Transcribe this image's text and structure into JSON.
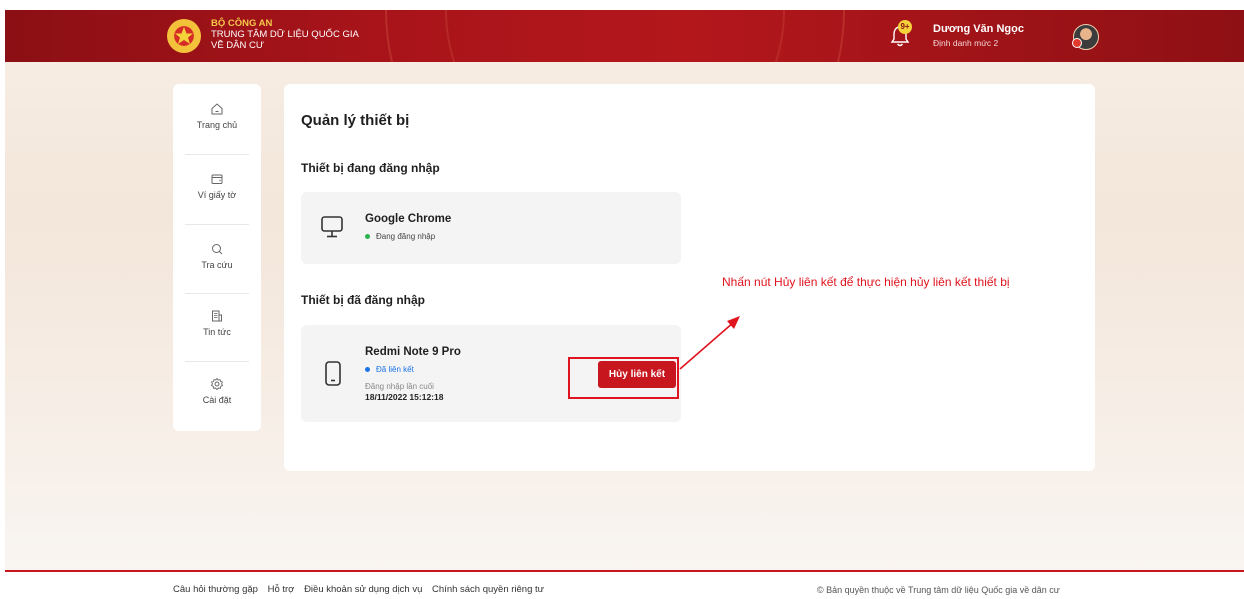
{
  "header": {
    "org_line1": "BỘ CÔNG AN",
    "org_line2": "TRUNG TÂM DỮ LIỆU QUỐC GIA",
    "org_line3": "VỀ DÂN CƯ",
    "notification_badge": "9+",
    "user_name": "Dương Văn Ngọc",
    "user_level": "Định danh mức 2"
  },
  "sidebar": {
    "items": [
      {
        "label": "Trang chủ",
        "icon": "home-icon"
      },
      {
        "label": "Ví giấy tờ",
        "icon": "wallet-icon"
      },
      {
        "label": "Tra cứu",
        "icon": "search-icon"
      },
      {
        "label": "Tin tức",
        "icon": "news-icon"
      },
      {
        "label": "Cài đặt",
        "icon": "gear-icon"
      }
    ]
  },
  "main": {
    "title": "Quản lý thiết bị",
    "current_section": "Thiết bị đang đăng nhập",
    "past_section": "Thiết bị đã đăng nhập",
    "current_device": {
      "name": "Google Chrome",
      "status": "Đang đăng nhập",
      "icon": "monitor-icon"
    },
    "past_device": {
      "name": "Redmi Note 9 Pro",
      "status": "Đã liên kết",
      "last_login_label": "Đăng nhập lần cuối",
      "last_login_time": "18/11/2022 15:12:18",
      "icon": "phone-icon",
      "unlink_label": "Hủy liên kết"
    }
  },
  "annotation": {
    "text": "Nhấn nút Hủy liên kết để thực hiện hủy liên kết thiết bị"
  },
  "footer": {
    "links": [
      "Câu hỏi thường gặp",
      "Hỗ trợ",
      "Điều khoản sử dụng dịch vụ",
      "Chính sách quyền riêng tư"
    ],
    "copyright": "© Bản quyền thuộc về Trung tâm dữ liệu Quốc gia về dân cư"
  },
  "colors": {
    "brand_red": "#b3171c",
    "accent_gold": "#f6c94a",
    "online_green": "#2bb24c",
    "linked_blue": "#1a73e8",
    "button_red": "#c8161e"
  }
}
